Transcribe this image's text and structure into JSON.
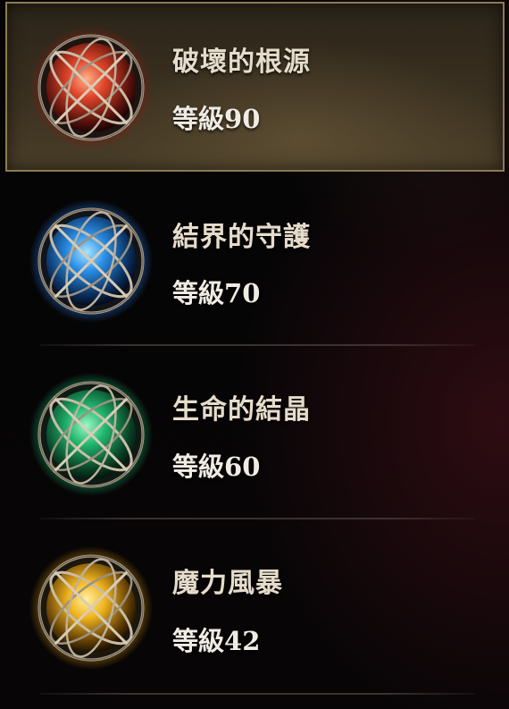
{
  "skills": [
    {
      "name": "破壞的根源",
      "level_prefix": "等級",
      "level": "90",
      "icon": "red-orb-icon",
      "orb_color": "#e0452a",
      "orb_glow": "#7a1d14",
      "selected": true
    },
    {
      "name": "結界的守護",
      "level_prefix": "等級",
      "level": "70",
      "icon": "blue-orb-icon",
      "orb_color": "#2a8fe8",
      "orb_glow": "#0f3c78",
      "selected": false
    },
    {
      "name": "生命的結晶",
      "level_prefix": "等級",
      "level": "60",
      "icon": "green-orb-icon",
      "orb_color": "#21b870",
      "orb_glow": "#0d5534",
      "selected": false
    },
    {
      "name": "魔力風暴",
      "level_prefix": "等級",
      "level": "42",
      "icon": "yellow-orb-icon",
      "orb_color": "#f0b41e",
      "orb_glow": "#7a5208",
      "selected": false
    }
  ],
  "colors": {
    "highlight_border": "#8c7a52",
    "text": "#e6dccb"
  }
}
